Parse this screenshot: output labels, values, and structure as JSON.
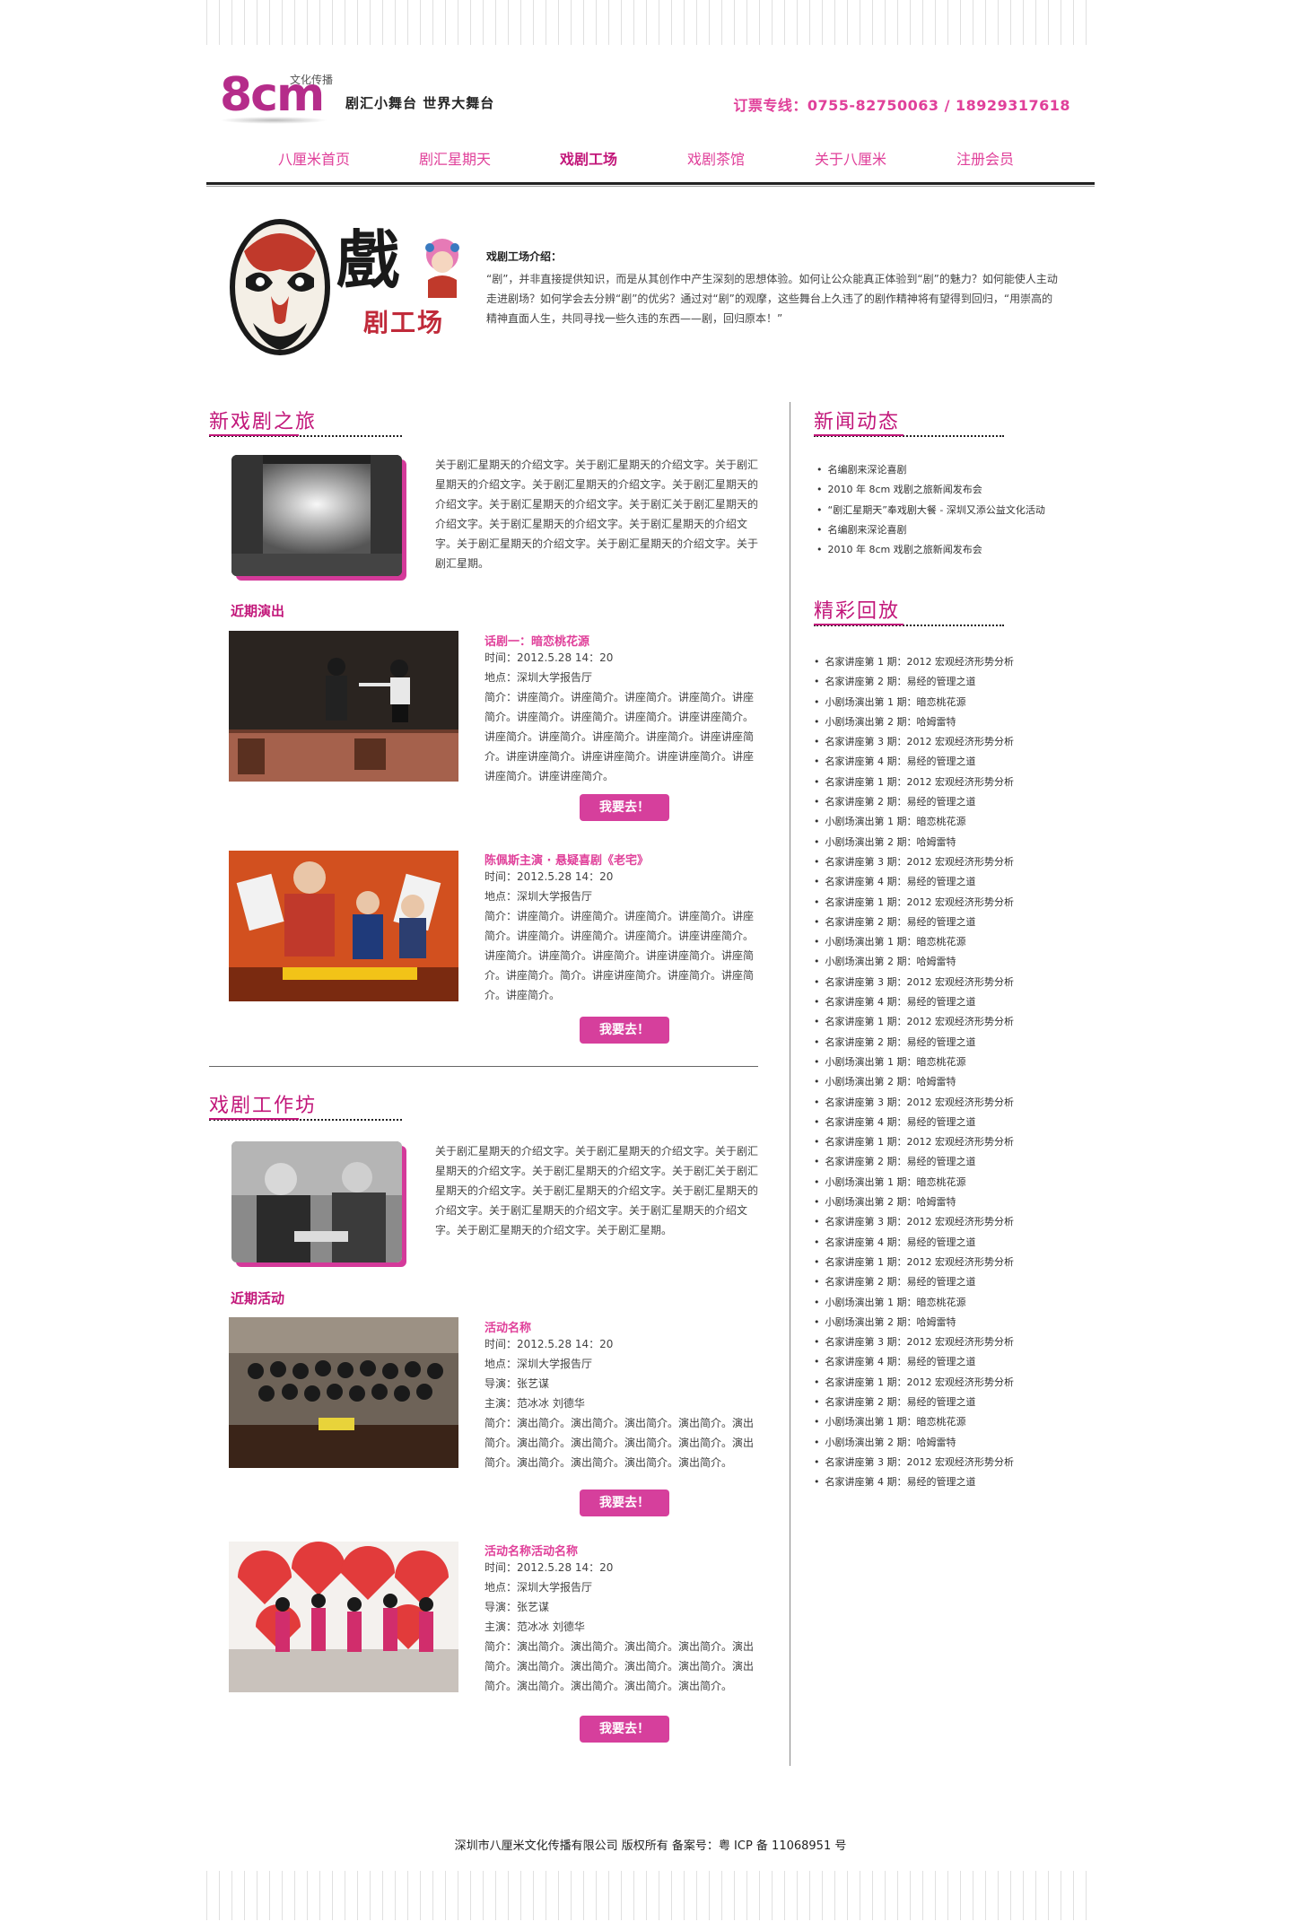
{
  "header": {
    "logo_text": "8cm",
    "logo_sub": "文化传播",
    "slogan": "剧汇小舞台 世界大舞台",
    "hotline": "订票专线：0755-82750063 / 18929317618"
  },
  "nav": {
    "items": [
      {
        "label": "八厘米首页"
      },
      {
        "label": "剧汇星期天"
      },
      {
        "label": "戏剧工场"
      },
      {
        "label": "戏剧茶馆"
      },
      {
        "label": "关于八厘米"
      },
      {
        "label": "注册会员"
      }
    ],
    "active_index": 2
  },
  "intro": {
    "banner_title": "戲",
    "banner_sub": "剧工场",
    "heading": "戏剧工场介绍：",
    "text": "“剧”，并非直接提供知识，而是从其创作中产生深刻的思想体验。如何让公众能真正体验到“剧”的魅力？如何能使人主动走进剧场？如何学会去分辨“剧”的优劣？通过对“剧”的观摩，这些舞台上久违了的剧作精神将有望得到回归，“用崇高的精神直面人生，共同寻找一些久违的东西——剧，回归原本！”"
  },
  "journey": {
    "title": "新戏剧之旅",
    "text": "关于剧汇星期天的介绍文字。关于剧汇星期天的介绍文字。关于剧汇星期天的介绍文字。关于剧汇星期天的介绍文字。关于剧汇星期天的介绍文字。关于剧汇星期天的介绍文字。关于剧汇关于剧汇星期天的介绍文字。关于剧汇星期天的介绍文字。关于剧汇星期天的介绍文字。关于剧汇星期天的介绍文字。关于剧汇星期天的介绍文字。关于剧汇星期。",
    "recent_label": "近期演出",
    "events": [
      {
        "title": "话剧一：暗恋桃花源",
        "time": "时间：2012.5.28  14：20",
        "place": "地点：深圳大学报告厅",
        "desc": "简介：讲座简介。讲座简介。讲座简介。讲座简介。讲座简介。讲座简介。讲座简介。讲座简介。讲座讲座简介。讲座简介。讲座简介。讲座简介。讲座简介。讲座讲座简介。讲座讲座简介。讲座讲座简介。讲座讲座简介。讲座讲座简介。讲座讲座简介。",
        "button": "我要去！"
      },
      {
        "title": "陈佩斯主演 · 悬疑喜剧《老宅》",
        "time": "时间：2012.5.28  14：20",
        "place": "地点：深圳大学报告厅",
        "desc": "简介：讲座简介。讲座简介。讲座简介。讲座简介。讲座简介。讲座简介。讲座简介。讲座简介。讲座讲座简介。讲座简介。讲座简介。讲座简介。讲座讲座简介。讲座简介。讲座简介。简介。讲座讲座简介。讲座简介。讲座简介。讲座简介。",
        "button": "我要去！"
      }
    ]
  },
  "workshop": {
    "title": "戏剧工作坊",
    "text": "关于剧汇星期天的介绍文字。关于剧汇星期天的介绍文字。关于剧汇星期天的介绍文字。关于剧汇星期天的介绍文字。关于剧汇关于剧汇星期天的介绍文字。关于剧汇星期天的介绍文字。关于剧汇星期天的介绍文字。关于剧汇星期天的介绍文字。关于剧汇星期天的介绍文字。关于剧汇星期天的介绍文字。关于剧汇星期。",
    "recent_label": "近期活动",
    "events": [
      {
        "title": "活动名称",
        "time": "时间：2012.5.28  14：20",
        "place": "地点：深圳大学报告厅",
        "director": "导演：张艺谋",
        "cast": "主演：范冰冰  刘德华",
        "desc": "简介：演出简介。演出简介。演出简介。演出简介。演出简介。演出简介。演出简介。演出简介。演出简介。演出简介。演出简介。演出简介。演出简介。演出简介。",
        "button": "我要去！"
      },
      {
        "title": "活动名称活动名称",
        "time": "时间：2012.5.28  14：20",
        "place": "地点：深圳大学报告厅",
        "director": "导演：张艺谋",
        "cast": "主演：范冰冰  刘德华",
        "desc": "简介：演出简介。演出简介。演出简介。演出简介。演出简介。演出简介。演出简介。演出简介。演出简介。演出简介。演出简介。演出简介。演出简介。演出简介。",
        "button": "我要去！"
      }
    ]
  },
  "news": {
    "title": "新闻动态",
    "items": [
      "名编剧来深论喜剧",
      "2010 年 8cm 戏剧之旅新闻发布会",
      "“剧汇星期天”奉戏剧大餐 - 深圳又添公益文化活动",
      "名编剧来深论喜剧",
      "2010 年 8cm 戏剧之旅新闻发布会"
    ]
  },
  "replay": {
    "title": "精彩回放",
    "items": [
      "名家讲座第 1 期：2012 宏观经济形势分析",
      "名家讲座第 2 期：易经的管理之道",
      "小剧场演出第 1 期：暗恋桃花源",
      "小剧场演出第 2 期：哈姆雷特",
      "名家讲座第 3 期：2012 宏观经济形势分析",
      "名家讲座第 4 期：易经的管理之道",
      "名家讲座第 1 期：2012 宏观经济形势分析",
      "名家讲座第 2 期：易经的管理之道",
      "小剧场演出第 1 期：暗恋桃花源",
      "小剧场演出第 2 期：哈姆雷特",
      "名家讲座第 3 期：2012 宏观经济形势分析",
      "名家讲座第 4 期：易经的管理之道",
      "名家讲座第 1 期：2012 宏观经济形势分析",
      "名家讲座第 2 期：易经的管理之道",
      "小剧场演出第 1 期：暗恋桃花源",
      "小剧场演出第 2 期：哈姆雷特",
      "名家讲座第 3 期：2012 宏观经济形势分析",
      "名家讲座第 4 期：易经的管理之道",
      "名家讲座第 1 期：2012 宏观经济形势分析",
      "名家讲座第 2 期：易经的管理之道",
      "小剧场演出第 1 期：暗恋桃花源",
      "小剧场演出第 2 期：哈姆雷特",
      "名家讲座第 3 期：2012 宏观经济形势分析",
      "名家讲座第 4 期：易经的管理之道",
      "名家讲座第 1 期：2012 宏观经济形势分析",
      "名家讲座第 2 期：易经的管理之道",
      "小剧场演出第 1 期：暗恋桃花源",
      "小剧场演出第 2 期：哈姆雷特",
      "名家讲座第 3 期：2012 宏观经济形势分析",
      "名家讲座第 4 期：易经的管理之道",
      "名家讲座第 1 期：2012 宏观经济形势分析",
      "名家讲座第 2 期：易经的管理之道",
      "小剧场演出第 1 期：暗恋桃花源",
      "小剧场演出第 2 期：哈姆雷特",
      "名家讲座第 3 期：2012 宏观经济形势分析",
      "名家讲座第 4 期：易经的管理之道",
      "名家讲座第 1 期：2012 宏观经济形势分析",
      "名家讲座第 2 期：易经的管理之道",
      "小剧场演出第 1 期：暗恋桃花源",
      "小剧场演出第 2 期：哈姆雷特",
      "名家讲座第 3 期：2012 宏观经济形势分析",
      "名家讲座第 4 期：易经的管理之道"
    ]
  },
  "footer": {
    "text": "深圳市八厘米文化传播有限公司 版权所有   备案号：粤 ICP 备 11068951 号"
  },
  "colors": {
    "accent": "#e0409a",
    "accent_dark": "#c2177a",
    "button": "#d63f9c"
  }
}
